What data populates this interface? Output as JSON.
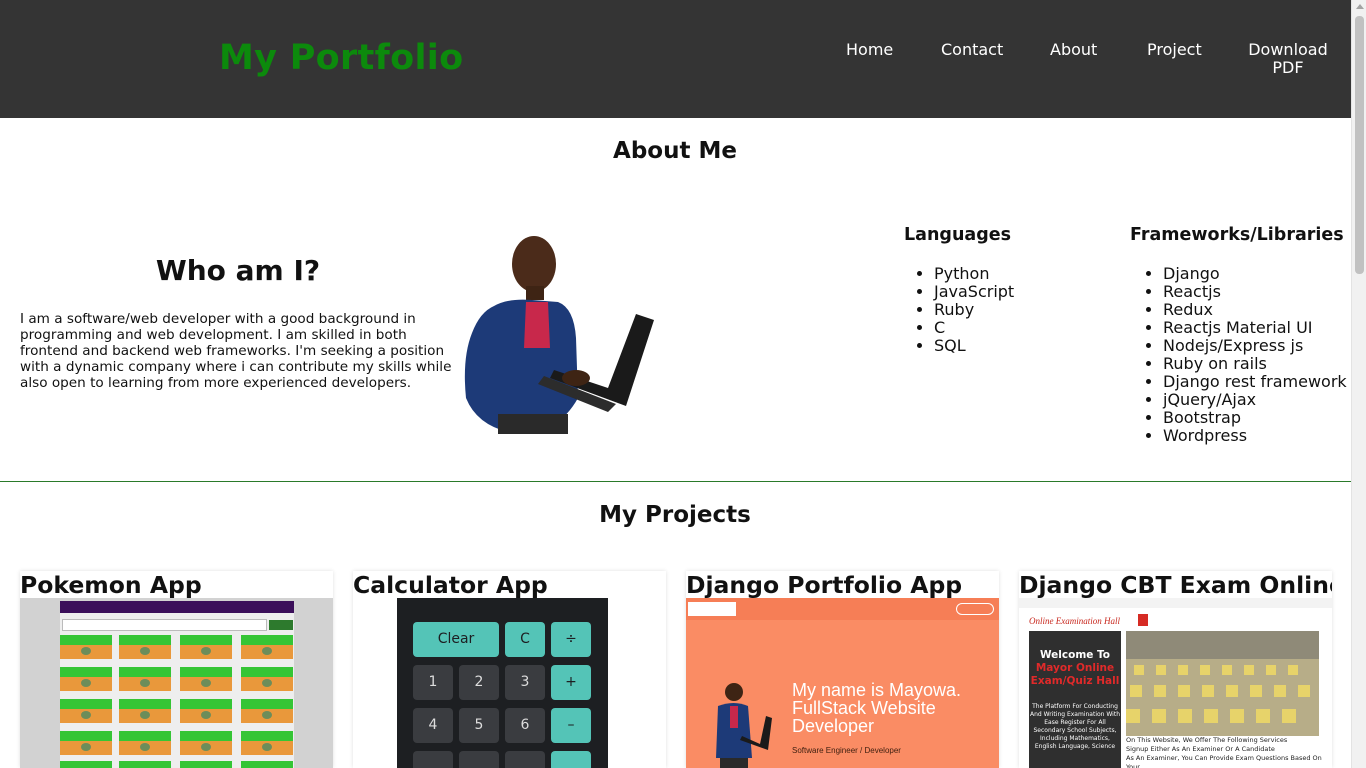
{
  "header": {
    "brand": "My Portfolio",
    "nav": [
      "Home",
      "Contact",
      "About",
      "Project",
      "Download PDF"
    ]
  },
  "about": {
    "title": "About Me",
    "who_title": "Who am I?",
    "bio": "I am a software/web developer with a good background in programming and web development. I am skilled in both frontend and backend web frameworks. I'm seeking a position with a dynamic company where i can contribute my skills while also open to learning from more experienced developers.",
    "languages_title": "Languages",
    "languages": [
      "Python",
      "JavaScript",
      "Ruby",
      "C",
      "SQL"
    ],
    "frameworks_title": "Frameworks/Libraries",
    "frameworks": [
      "Django",
      "Reactjs",
      "Redux",
      "Reactjs Material UI",
      "Nodejs/Express js",
      "Ruby on rails",
      "Django rest framework",
      "jQuery/Ajax",
      "Bootstrap",
      "Wordpress"
    ]
  },
  "projects": {
    "title": "My Projects",
    "cards": [
      {
        "title": "Pokemon App"
      },
      {
        "title": "Calculator App"
      },
      {
        "title": "Django Portfolio App"
      },
      {
        "title": "Django CBT Exam Online"
      }
    ]
  },
  "calculator": {
    "keys": [
      "Clear",
      "C",
      "÷",
      "1",
      "2",
      "3",
      "+",
      "4",
      "5",
      "6",
      "–"
    ]
  },
  "portfolio_preview": {
    "headline_1": "My name is Mayowa.",
    "headline_2": "FullStack Website",
    "headline_3": "Developer",
    "subline": "Software Engineer / Developer"
  },
  "cbt_preview": {
    "brand": "Online Examination Hall",
    "welcome_1": "Welcome To",
    "welcome_2": "Mayor Online",
    "welcome_3": "Exam/Quiz Hall",
    "blurb": "The Platform For Conducting And Writing Examination With Ease Register For All Secondary School Subjects, Including Mathematics, English Language, Science",
    "caption_1": "On This Website, We Offer The Following Services",
    "caption_2": "Signup Either As An Examiner Or A Candidate",
    "caption_3": "As An Examiner, You Can Provide Exam Questions Based On Your"
  },
  "colors": {
    "header_bg": "#343434",
    "brand_green": "#0c8a0c",
    "teal": "#54c4b7",
    "salmon": "#fa8c64"
  }
}
